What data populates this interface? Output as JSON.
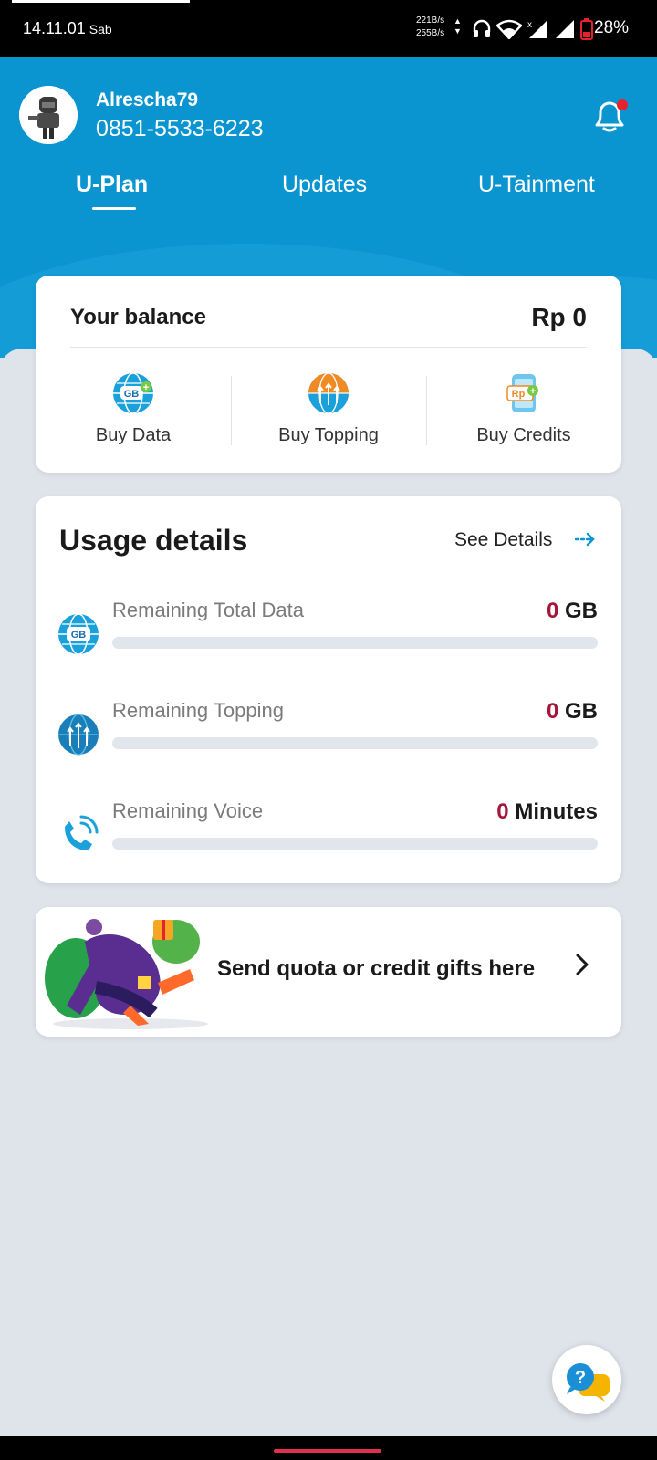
{
  "status_bar": {
    "time": "14.11.01",
    "day": "Sab",
    "net_up": "221B/s",
    "net_down": "255B/s",
    "battery": "28%",
    "icons": [
      "headphones-icon",
      "wifi-icon",
      "signal-icon",
      "signal-icon",
      "battery-icon"
    ]
  },
  "profile": {
    "username": "Alrescha79",
    "phone": "0851-5533-6223",
    "notification_dot_color": "#e8212e"
  },
  "tabs": [
    {
      "label": "U-Plan",
      "active": true
    },
    {
      "label": "Updates",
      "active": false
    },
    {
      "label": "U-Tainment",
      "active": false
    }
  ],
  "balance": {
    "label": "Your balance",
    "value": "Rp 0",
    "actions": [
      {
        "label": "Buy Data",
        "icon": "gb-globe-icon"
      },
      {
        "label": "Buy Topping",
        "icon": "topping-globe-icon"
      },
      {
        "label": "Buy Credits",
        "icon": "rp-phone-icon"
      }
    ]
  },
  "usage": {
    "title": "Usage details",
    "see_details": "See Details",
    "items": [
      {
        "label": "Remaining Total Data",
        "value_num": "0",
        "value_unit": "GB",
        "fraction": 0,
        "icon": "gb-globe-icon"
      },
      {
        "label": "Remaining Topping",
        "value_num": "0",
        "value_unit": "GB",
        "fraction": 0,
        "icon": "topping-globe-icon"
      },
      {
        "label": "Remaining Voice",
        "value_num": "0",
        "value_unit": "Minutes",
        "fraction": 0,
        "icon": "phone-call-icon"
      }
    ]
  },
  "gift": {
    "text": "Send quota or credit gifts here"
  },
  "colors": {
    "brand_blue": "#0a95d1",
    "value_red": "#a5163a"
  }
}
